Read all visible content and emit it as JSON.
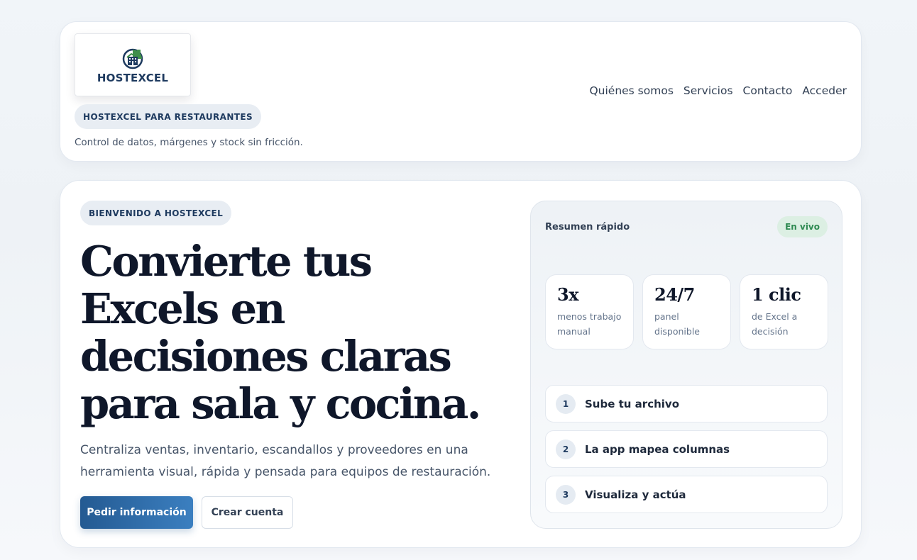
{
  "header": {
    "logo_text": "HOSTEXCEL",
    "brand_pill": "HOSTEXCEL PARA RESTAURANTES",
    "tagline": "Control de datos, márgenes y stock sin fricción.",
    "nav": [
      "Quiénes somos",
      "Servicios",
      "Contacto",
      "Acceder"
    ]
  },
  "hero": {
    "welcome_pill": "BIENVENIDO A HOSTEXCEL",
    "title": "Convierte tus Excels en decisiones claras para sala y cocina.",
    "description": "Centraliza ventas, inventario, escandallos y proveedores en una herramienta visual, rápida y pensada para equipos de restauración.",
    "primary_button": "Pedir información",
    "secondary_button": "Crear cuenta"
  },
  "summary": {
    "title": "Resumen rápido",
    "badge": "En vivo",
    "stats": [
      {
        "value": "3x",
        "label": "menos trabajo manual"
      },
      {
        "value": "24/7",
        "label": "panel disponible"
      },
      {
        "value": "1 clic",
        "label": "de Excel a decisión"
      }
    ],
    "steps": [
      {
        "num": "1",
        "label": "Sube tu archivo"
      },
      {
        "num": "2",
        "label": "La app mapea columnas"
      },
      {
        "num": "3",
        "label": "Visualiza y actúa"
      }
    ]
  },
  "colors": {
    "brand_navy": "#1e3a5f",
    "primary_button": "#2d6aa8",
    "live_green": "#2f8a52"
  }
}
